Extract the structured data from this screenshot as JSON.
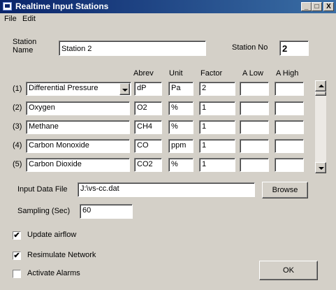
{
  "window": {
    "title": "Realtime Input Stations",
    "minimize": "_",
    "maximize": "□",
    "close": "X"
  },
  "menu": {
    "file": "File",
    "edit": "Edit"
  },
  "station": {
    "name_label_1": "Station",
    "name_label_2": "Name",
    "name_value": "Station  2",
    "no_label": "Station No",
    "no_value": "2"
  },
  "columns": {
    "abrev": "Abrev",
    "unit": "Unit",
    "factor": "Factor",
    "alow": "A Low",
    "ahigh": "A High"
  },
  "rows": [
    {
      "index": "(1)",
      "name": "Differential Pressure",
      "abrev": "dP",
      "unit": "Pa",
      "factor": "2",
      "alow": "",
      "ahigh": ""
    },
    {
      "index": "(2)",
      "name": "Oxygen",
      "abrev": "O2",
      "unit": "%",
      "factor": "1",
      "alow": "",
      "ahigh": ""
    },
    {
      "index": "(3)",
      "name": "Methane",
      "abrev": "CH4",
      "unit": "%",
      "factor": "1",
      "alow": "",
      "ahigh": ""
    },
    {
      "index": "(4)",
      "name": "Carbon Monoxide",
      "abrev": "CO",
      "unit": "ppm",
      "factor": "1",
      "alow": "",
      "ahigh": ""
    },
    {
      "index": "(5)",
      "name": "Carbon Dioxide",
      "abrev": "CO2",
      "unit": "%",
      "factor": "1",
      "alow": "",
      "ahigh": ""
    }
  ],
  "input_file": {
    "label": "Input Data File",
    "value": "J:\\vs-cc.dat",
    "browse": "Browse"
  },
  "sampling": {
    "label": "Sampling (Sec)",
    "value": "60"
  },
  "options": {
    "update_airflow": {
      "label": "Update airflow",
      "checked": true
    },
    "resimulate": {
      "label": "Resimulate Network",
      "checked": true
    },
    "alarms": {
      "label": "Activate Alarms",
      "checked": false
    }
  },
  "ok": "OK"
}
